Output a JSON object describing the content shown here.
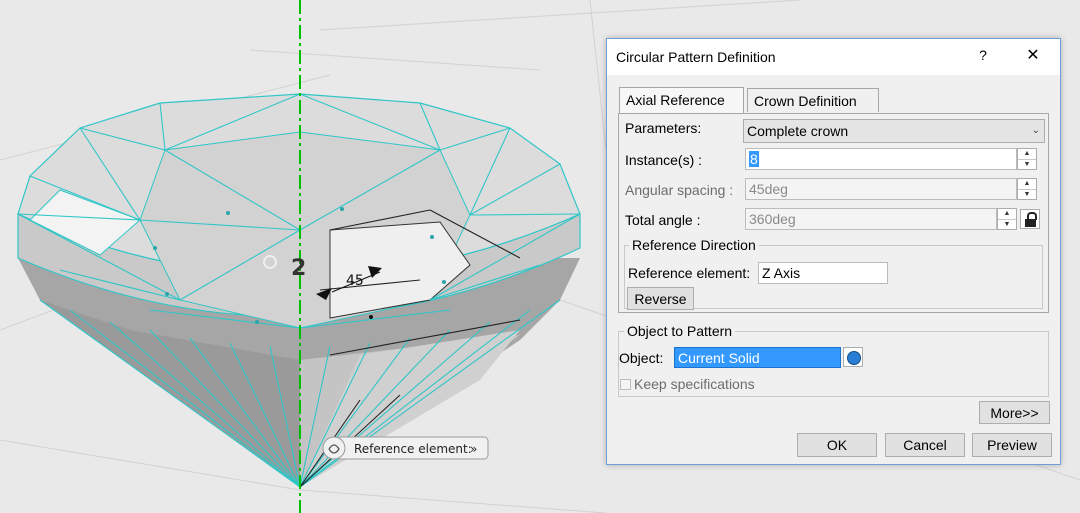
{
  "viewport": {
    "edge_color": "#2fc6c8",
    "axis_color": "#00c000",
    "number_label": "2",
    "angle_label": "45",
    "tooltip_label": "Reference element:",
    "tooltip_chevron": "»"
  },
  "dialog": {
    "title": "Circular Pattern Definition",
    "help_label": "?",
    "close_label": "✕",
    "tabs": [
      {
        "label": "Axial Reference",
        "active": true
      },
      {
        "label": "Crown Definition",
        "active": false
      }
    ],
    "parameters": {
      "label": "Parameters:",
      "value": "Complete crown"
    },
    "instances": {
      "label": "Instance(s) :",
      "value": "8"
    },
    "angular_spacing": {
      "label": "Angular spacing :",
      "value": "45deg"
    },
    "total_angle": {
      "label": "Total angle :",
      "value": "360deg"
    },
    "reference_direction": {
      "title": "Reference Direction",
      "element_label": "Reference element:",
      "element_value": "Z Axis",
      "reverse_label": "Reverse"
    },
    "object_to_pattern": {
      "title": "Object to Pattern",
      "object_label": "Object:",
      "object_value": "Current Solid",
      "keep_spec_label": "Keep specifications"
    },
    "more_label": "More>>",
    "ok_label": "OK",
    "cancel_label": "Cancel",
    "preview_label": "Preview"
  }
}
